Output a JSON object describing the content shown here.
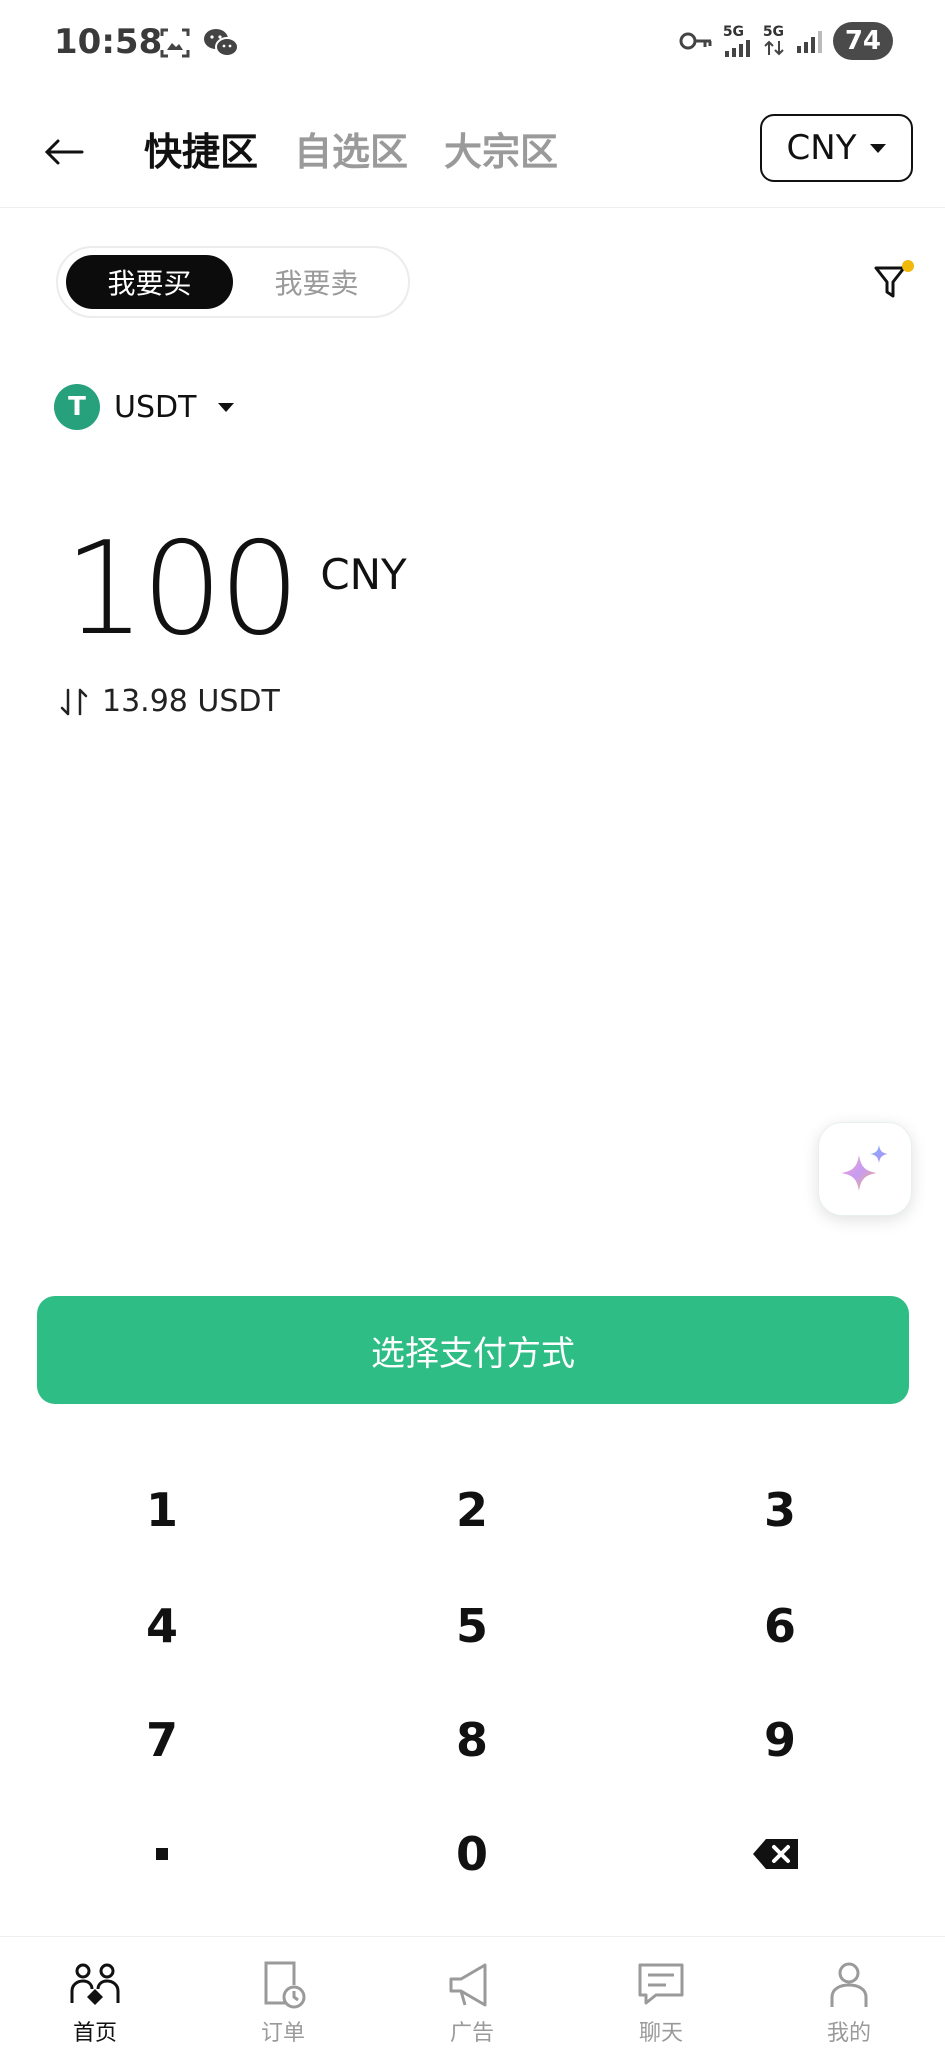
{
  "status_bar": {
    "time": "10:58",
    "battery": "74",
    "net_1": "5G",
    "net_2": "5G"
  },
  "header": {
    "tabs": [
      {
        "label": "快捷区",
        "active": true
      },
      {
        "label": "自选区",
        "active": false
      },
      {
        "label": "大宗区",
        "active": false
      }
    ],
    "currency": "CNY"
  },
  "toggle": {
    "buy": "我要买",
    "sell": "我要卖",
    "selected": "buy"
  },
  "coin": {
    "name": "USDT",
    "logo_letter": "T",
    "color": "#26a17b"
  },
  "amount": {
    "value": "100",
    "currency": "CNY",
    "converted": "13.98 USDT"
  },
  "pay_button": "选择支付方式",
  "keypad": [
    "1",
    "2",
    "3",
    "4",
    "5",
    "6",
    "7",
    "8",
    "9",
    "0"
  ],
  "bottom_nav": [
    {
      "label": "首页",
      "icon": "home-people-icon",
      "active": true
    },
    {
      "label": "订单",
      "icon": "order-clock-icon",
      "active": false
    },
    {
      "label": "广告",
      "icon": "megaphone-icon",
      "active": false
    },
    {
      "label": "聊天",
      "icon": "chat-bubble-icon",
      "active": false
    },
    {
      "label": "我的",
      "icon": "person-icon",
      "active": false
    }
  ],
  "colors": {
    "accent": "#2ebd85",
    "filter_dot": "#f0b90b"
  }
}
